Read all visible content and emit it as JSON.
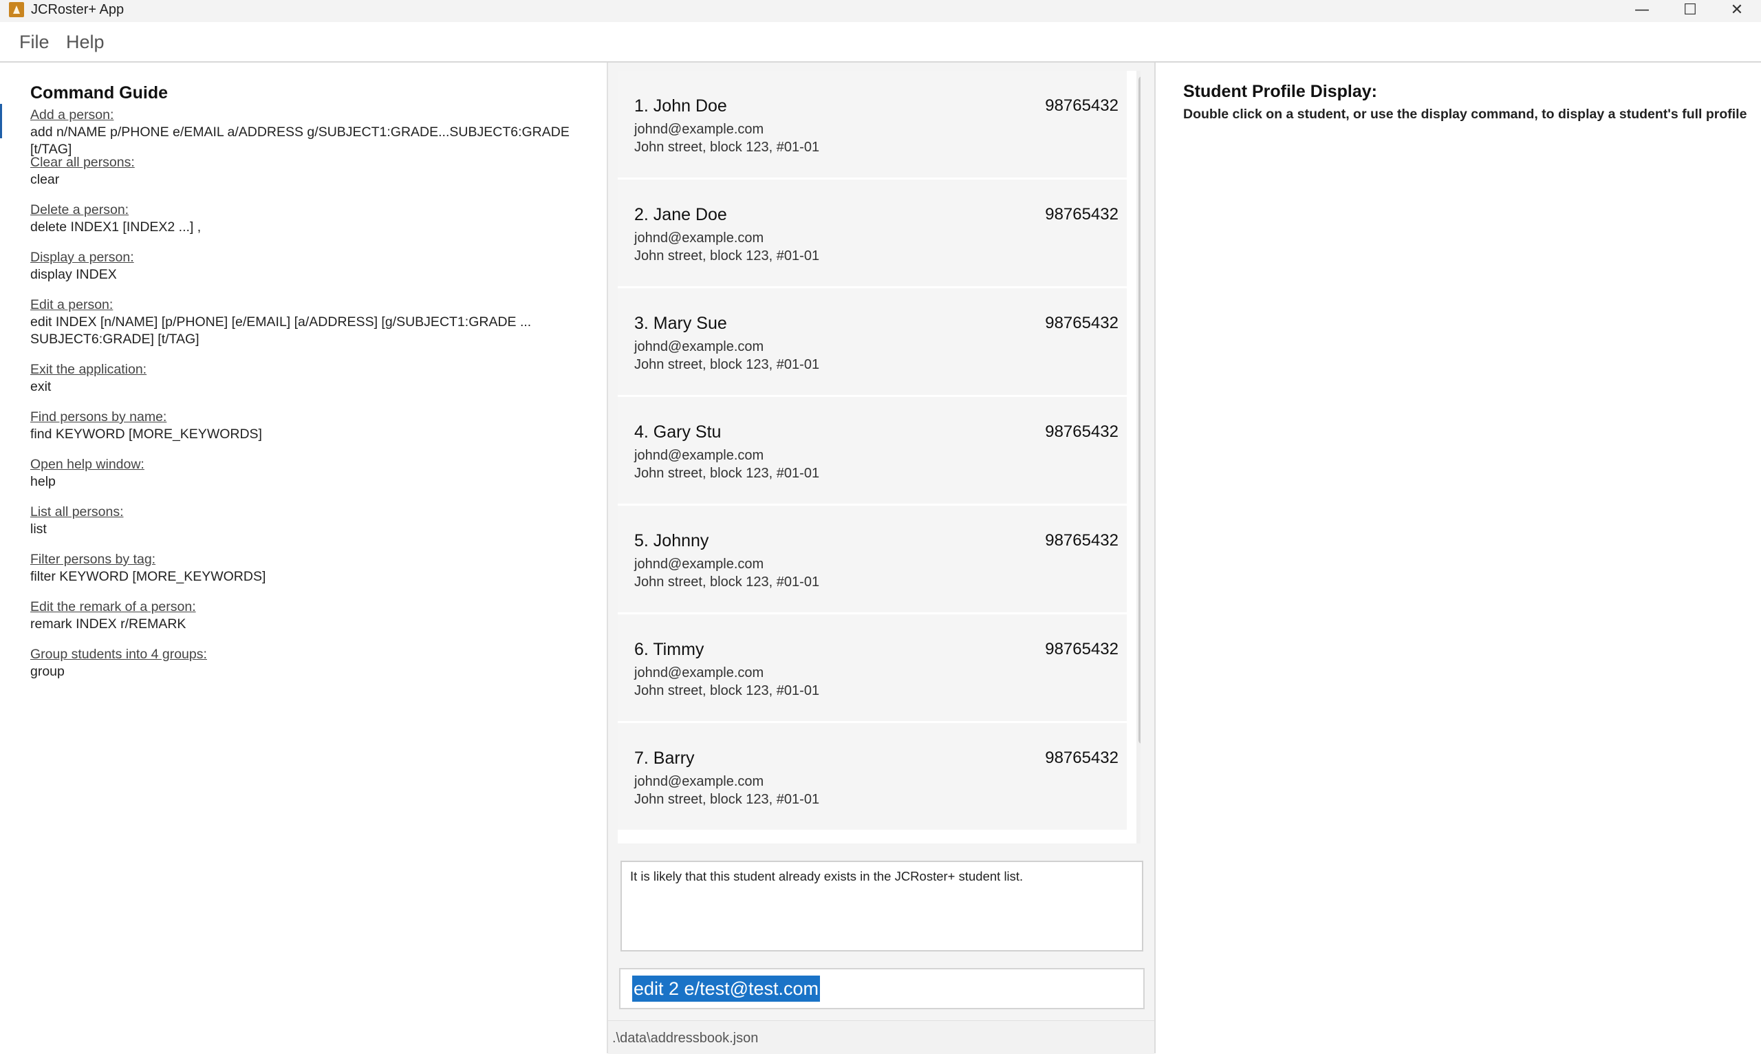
{
  "window": {
    "title": "JCRoster+ App",
    "controls": {
      "minimize": "—",
      "maximize": "☐",
      "close": "✕"
    }
  },
  "menu": [
    "File",
    "Help"
  ],
  "command_guide": {
    "title": "Command Guide",
    "items": [
      {
        "label": "Add a person:",
        "command": "add n/NAME p/PHONE e/EMAIL a/ADDRESS g/SUBJECT1:GRADE...SUBJECT6:GRADE [t/TAG]"
      },
      {
        "label": "Clear all persons:",
        "command": "clear"
      },
      {
        "label": "Delete a person:",
        "command": "delete INDEX1 [INDEX2 ...] ,"
      },
      {
        "label": "Display a person:",
        "command": "display INDEX"
      },
      {
        "label": "Edit a person:",
        "command": "edit INDEX [n/NAME] [p/PHONE] [e/EMAIL] [a/ADDRESS] [g/SUBJECT1:GRADE ...",
        "command2": "SUBJECT6:GRADE] [t/TAG]"
      },
      {
        "label": "Exit the application:",
        "command": "exit"
      },
      {
        "label": "Find persons by name:",
        "command": "find KEYWORD [MORE_KEYWORDS]"
      },
      {
        "label": "Open help window:",
        "command": "help"
      },
      {
        "label": "List all persons:",
        "command": "list"
      },
      {
        "label": "Filter persons by tag:",
        "command": "filter KEYWORD [MORE_KEYWORDS]"
      },
      {
        "label": "Edit the remark of a person:",
        "command": "remark INDEX r/REMARK"
      },
      {
        "label": "Group students into 4 groups:",
        "command": "group"
      }
    ]
  },
  "persons": [
    {
      "name": "1. John Doe",
      "phone": "98765432",
      "email": "johnd@example.com",
      "address": "John street, block 123, #01-01"
    },
    {
      "name": "2. Jane Doe",
      "phone": "98765432",
      "email": "johnd@example.com",
      "address": "John street, block 123, #01-01"
    },
    {
      "name": "3. Mary Sue",
      "phone": "98765432",
      "email": "johnd@example.com",
      "address": "John street, block 123, #01-01"
    },
    {
      "name": "4. Gary Stu",
      "phone": "98765432",
      "email": "johnd@example.com",
      "address": "John street, block 123, #01-01"
    },
    {
      "name": "5. Johnny",
      "phone": "98765432",
      "email": "johnd@example.com",
      "address": "John street, block 123, #01-01"
    },
    {
      "name": "6. Timmy",
      "phone": "98765432",
      "email": "johnd@example.com",
      "address": "John street, block 123, #01-01"
    },
    {
      "name": "7. Barry",
      "phone": "98765432",
      "email": "johnd@example.com",
      "address": "John street, block 123, #01-01"
    }
  ],
  "result_display": "It is likely that this student already exists in the JCRoster+ student list.",
  "command_box": {
    "value": "edit 2 e/test@test.com"
  },
  "status_bar": {
    "path": ".\\data\\addressbook.json"
  },
  "profile": {
    "title": "Student Profile Display:",
    "hint": "Double click on a student, or use the display command, to display a student's full profile"
  }
}
